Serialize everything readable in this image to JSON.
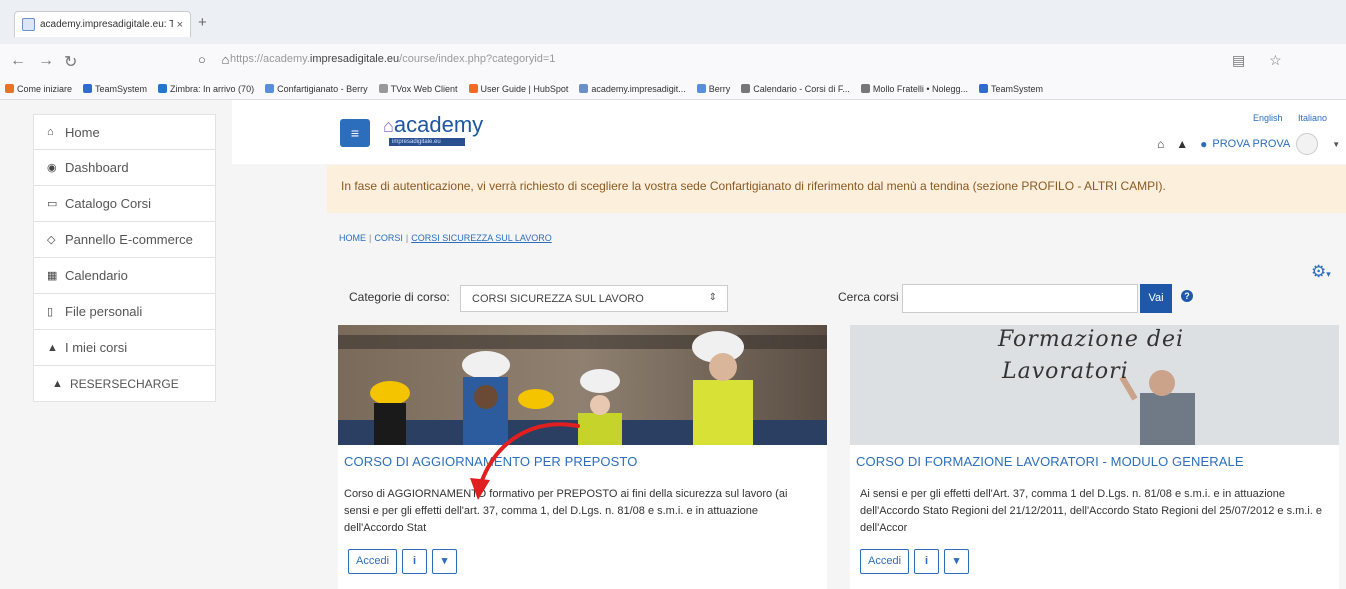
{
  "browser": {
    "tab_title": "academy.impresadigitale.eu: T...",
    "tab_close": "×",
    "new_tab": "+",
    "url_prefix": "https://academy.",
    "url_domain": "impresadigitale.eu",
    "url_path": "/course/index.php?categoryid=1",
    "bookmarks": [
      {
        "label": "Come iniziare",
        "color": "#e2742b"
      },
      {
        "label": "TeamSystem",
        "color": "#2f6bd1"
      },
      {
        "label": "Zimbra: In arrivo (70)",
        "color": "#2277cc"
      },
      {
        "label": "Confartigianato - Berry",
        "color": "#5a8fd8"
      },
      {
        "label": "TVox Web Client",
        "color": "#999999"
      },
      {
        "label": "User Guide | HubSpot",
        "color": "#f06a2a"
      },
      {
        "label": "academy.impresadigit...",
        "color": "#6b8fc7"
      },
      {
        "label": "Berry",
        "color": "#5a8fd8"
      },
      {
        "label": "Calendario - Corsi di F...",
        "color": "#777777"
      },
      {
        "label": "Mollo Fratelli • Nolegg...",
        "color": "#777777"
      },
      {
        "label": "TeamSystem",
        "color": "#2f6bd1"
      }
    ]
  },
  "sidebar": {
    "items": [
      {
        "label": "Home",
        "icon": "home-icon",
        "glyph": "⌂"
      },
      {
        "label": "Dashboard",
        "icon": "dashboard-icon",
        "glyph": "◉"
      },
      {
        "label": "Catalogo Corsi",
        "icon": "catalog-icon",
        "glyph": "▭"
      },
      {
        "label": "Pannello E-commerce",
        "icon": "ecommerce-icon",
        "glyph": "◇"
      },
      {
        "label": "Calendario",
        "icon": "calendar-icon",
        "glyph": "▦"
      },
      {
        "label": "File personali",
        "icon": "file-icon",
        "glyph": "▯"
      },
      {
        "label": "I miei corsi",
        "icon": "graduation-cap-icon",
        "glyph": "▲"
      },
      {
        "label": "RESERSECHARGE",
        "icon": "graduation-cap-icon",
        "glyph": "▲"
      }
    ]
  },
  "header": {
    "logo_text": "academy",
    "logo_tagline": "impresadigitale.eu",
    "lang_english": "English",
    "lang_italiano": "Italiano",
    "user_name": "PROVA PROVA"
  },
  "alert": {
    "text": "In fase di autenticazione, vi verrà richiesto di scegliere la vostra sede Confartigianato di riferimento dal menù a tendina (sezione PROFILO - ALTRI CAMPI)."
  },
  "breadcrumb": {
    "home": "HOME",
    "corsi": "CORSI",
    "current": "CORSI SICUREZZA SUL LAVORO",
    "sep": "|"
  },
  "filters": {
    "category_label": "Categorie di corso:",
    "category_value": "CORSI SICUREZZA SUL LAVORO",
    "search_label": "Cerca corsi",
    "search_button": "Vai",
    "help": "?"
  },
  "courses": [
    {
      "title": "CORSO DI AGGIORNAMENTO PER PREPOSTO",
      "description": "Corso di AGGIORNAMENTO formativo per  PREPOSTO ai fini della sicurezza sul lavoro (ai sensi e per gli effetti dell'art. 37, comma 1, del D.Lgs. n. 81/08 e s.m.i. e in attuazione dell'Accordo Stat",
      "access_label": "Accedi",
      "info_label": "i",
      "cart_label": "🛒"
    },
    {
      "title": "CORSO DI FORMAZIONE LAVORATORI - MODULO GENERALE",
      "description": "Ai sensi e per gli effetti dell'Art. 37, comma 1 del D.Lgs. n. 81/08 e s.m.i. e in attuazione dell'Accordo Stato Regioni del 21/12/2011, dell'Accordo Stato Regioni del 25/07/2012 e s.m.i. e dell'Accor",
      "image_text_line1": "Formazione dei",
      "image_text_line2": "Lavoratori",
      "access_label": "Accedi",
      "info_label": "i",
      "cart_label": "🛒"
    }
  ],
  "colors": {
    "accent": "#2c6ebb",
    "alert_bg": "#fcefdc",
    "annotation_arrow": "#e02020"
  }
}
